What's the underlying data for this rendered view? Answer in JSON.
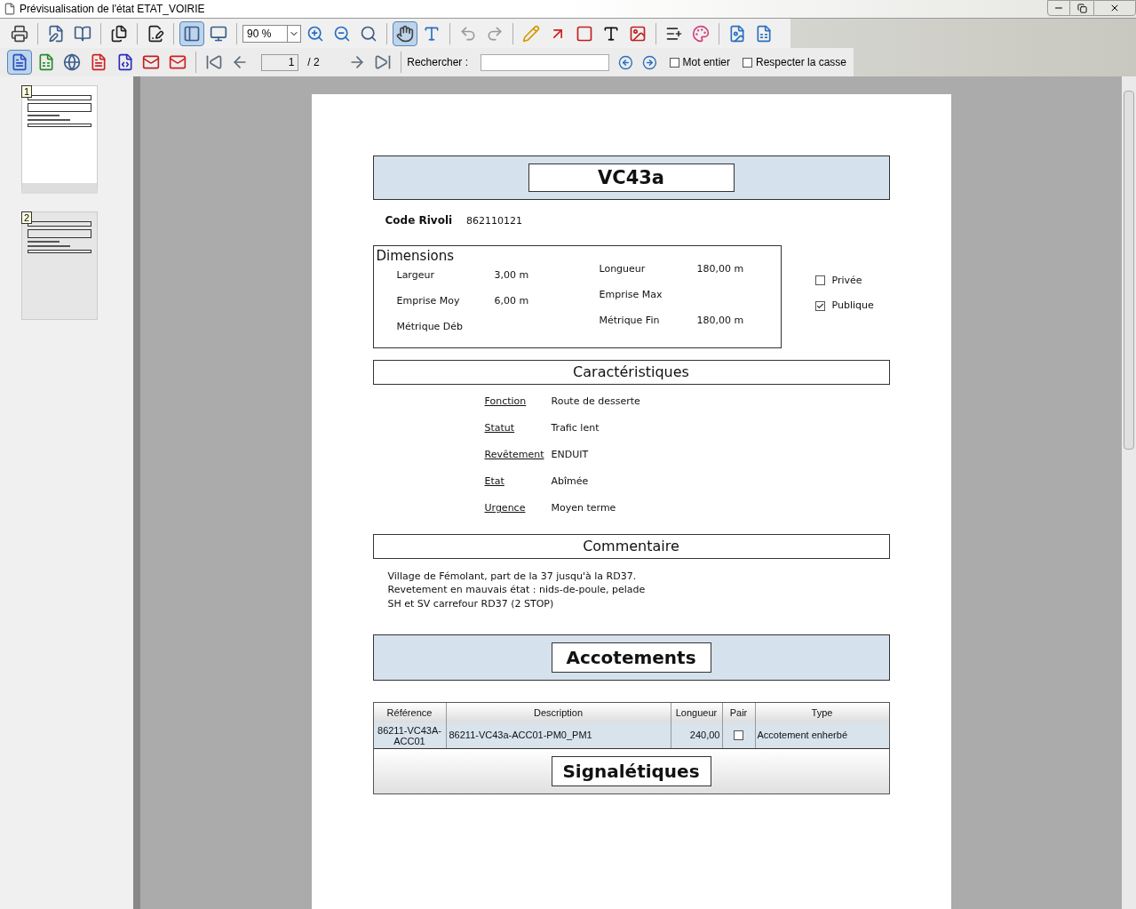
{
  "window": {
    "title": "Prévisualisation de l'état ETAT_VOIRIE"
  },
  "toolbar": {
    "zoom": "90 %",
    "page": "1",
    "page_count": "/ 2",
    "search_label": "Rechercher :",
    "options": [
      {
        "label": "Mot entier",
        "checked": false
      },
      {
        "label": "Respecter la casse",
        "checked": false
      }
    ]
  },
  "sidebar": {
    "thumbnails": [
      {
        "label": "1",
        "selected": true
      },
      {
        "label": "2",
        "selected": false
      }
    ]
  },
  "document": {
    "title": "VC43a",
    "code_rivoli": {
      "label": "Code Rivoli",
      "value": "862110121"
    },
    "dimensions": {
      "title": "Dimensions",
      "left": [
        {
          "label": "Largeur",
          "value": "3,00 m"
        },
        {
          "label": "Emprise Moy",
          "value": "6,00 m"
        },
        {
          "label": "Métrique Déb"
        }
      ],
      "right": [
        {
          "label": "Longueur",
          "value": "180,00 m"
        },
        {
          "label": "Emprise Max"
        },
        {
          "label": "Métrique Fin",
          "value": "180,00 m"
        }
      ]
    },
    "ownership": [
      {
        "label": "Privée",
        "checked": false
      },
      {
        "label": "Publique",
        "checked": true
      }
    ],
    "characteristics": {
      "title": "Caractéristiques",
      "rows": [
        {
          "label": "Fonction",
          "value": "Route de desserte"
        },
        {
          "label": "Statut",
          "value": "Trafic lent"
        },
        {
          "label": "Revêtement",
          "value": "ENDUIT"
        },
        {
          "label": "Etat",
          "value": "Abîmée"
        },
        {
          "label": "Urgence",
          "value": "Moyen terme"
        }
      ]
    },
    "comment": {
      "title": "Commentaire",
      "lines": [
        "Village de Fémolant, part de la 37 jusqu'à la RD37.",
        "Revetement en mauvais état : nids-de-poule, pelade",
        "SH et SV carrefour RD37 (2 STOP)"
      ]
    },
    "accotements": {
      "title": "Accotements",
      "columns": [
        "Référence",
        "Description",
        "Longueur",
        "Pair",
        "Type"
      ],
      "rows": [
        {
          "reference": "86211-VC43A-ACC01",
          "description": "86211-VC43a-ACC01-PM0_PM1",
          "longueur": "240,00",
          "pair": false,
          "type": "Accotement enherbé"
        }
      ]
    },
    "signaletiques": {
      "title": "Signalétiques"
    }
  }
}
